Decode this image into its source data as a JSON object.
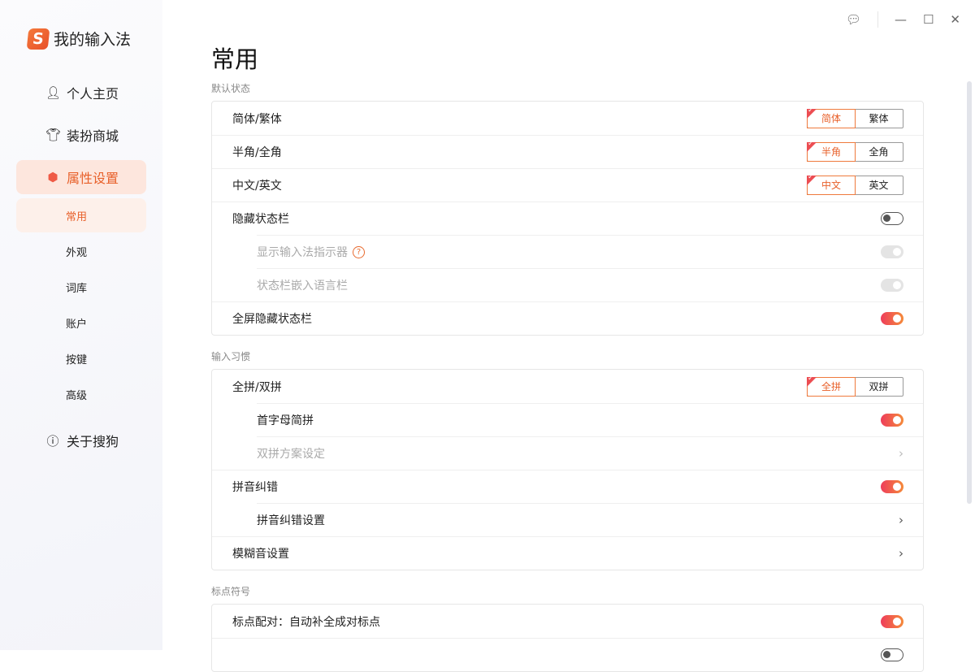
{
  "app": {
    "logo_letter": "S",
    "title": "我的输入法"
  },
  "sidebar": {
    "items": [
      {
        "label": "个人主页",
        "icon": "user-icon"
      },
      {
        "label": "装扮商城",
        "icon": "shirt-icon"
      },
      {
        "label": "属性设置",
        "icon": "settings-hex-icon"
      }
    ],
    "sub_items": [
      "常用",
      "外观",
      "词库",
      "账户",
      "按键",
      "高级"
    ],
    "about": "关于搜狗"
  },
  "page": {
    "title": "常用"
  },
  "sections": [
    {
      "label": "默认状态",
      "rows": [
        {
          "label": "简体/繁体",
          "type": "seg",
          "options": [
            "简体",
            "繁体"
          ],
          "selected": 0
        },
        {
          "label": "半角/全角",
          "type": "seg",
          "options": [
            "半角",
            "全角"
          ],
          "selected": 0
        },
        {
          "label": "中文/英文",
          "type": "seg",
          "options": [
            "中文",
            "英文"
          ],
          "selected": 0
        },
        {
          "label": "隐藏状态栏",
          "type": "toggle",
          "state": "off"
        },
        {
          "label": "显示输入法指示器",
          "type": "toggle",
          "state": "dis",
          "indent": true,
          "disabled": true,
          "help": "?"
        },
        {
          "label": "状态栏嵌入语言栏",
          "type": "toggle",
          "state": "dis",
          "indent": true,
          "disabled": true
        },
        {
          "label": "全屏隐藏状态栏",
          "type": "toggle",
          "state": "on"
        }
      ]
    },
    {
      "label": "输入习惯",
      "rows": [
        {
          "label": "全拼/双拼",
          "type": "seg",
          "options": [
            "全拼",
            "双拼"
          ],
          "selected": 0
        },
        {
          "label": "首字母简拼",
          "type": "toggle",
          "state": "on",
          "indent": true
        },
        {
          "label": "双拼方案设定",
          "type": "chev",
          "indent": true,
          "disabled": true
        },
        {
          "label": "拼音纠错",
          "type": "toggle",
          "state": "on"
        },
        {
          "label": "拼音纠错设置",
          "type": "chev",
          "indent": true
        },
        {
          "label": "模糊音设置",
          "type": "chev"
        }
      ]
    },
    {
      "label": "标点符号",
      "rows": [
        {
          "label": "标点配对：自动补全成对标点",
          "type": "toggle",
          "state": "on"
        },
        {
          "label": "",
          "type": "toggle",
          "state": "off"
        }
      ]
    }
  ]
}
